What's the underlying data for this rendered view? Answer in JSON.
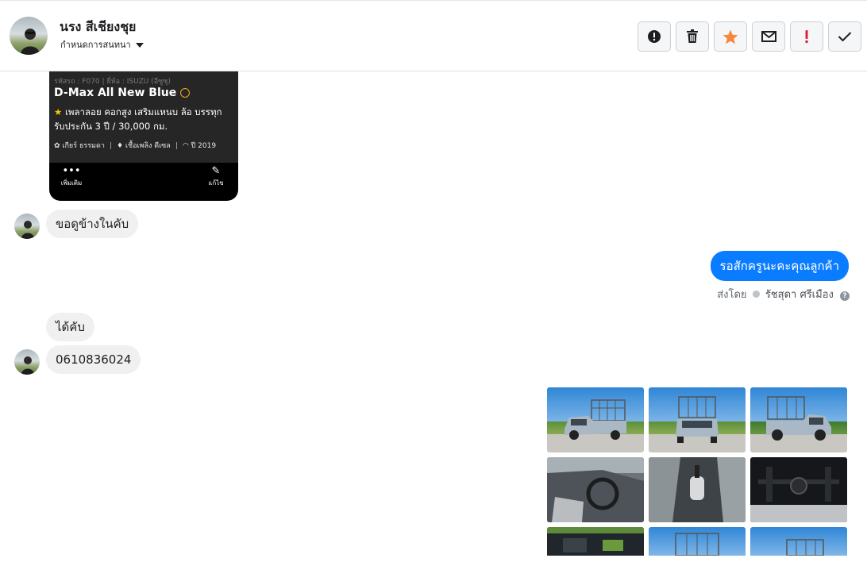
{
  "header": {
    "contact_name": "นรง สีเชียงชุย",
    "assign_label": "กำหนดการสนทนา"
  },
  "toolbar": [
    {
      "name": "report-button",
      "icon": "alert-circle-icon",
      "color": "#1c1e21"
    },
    {
      "name": "delete-button",
      "icon": "trash-icon",
      "color": "#1c1e21"
    },
    {
      "name": "star-button",
      "icon": "star-icon",
      "color": "#f5883b"
    },
    {
      "name": "mark-unread-button",
      "icon": "envelope-icon",
      "color": "#1c1e21"
    },
    {
      "name": "follow-up-button",
      "icon": "exclamation-icon",
      "color": "#e41e3f"
    },
    {
      "name": "mark-done-button",
      "icon": "check-icon",
      "color": "#1c1e21"
    }
  ],
  "listing_card": {
    "meta": "รหัสรถ : F070 | ยี่ห้อ : ISUZU (อีซูซุ)",
    "model": "D-Max All New Blue",
    "features": "เพลาลอย คอกสูง เสริมแหนบ ล้อ บรรทุก รับประกัน 3 ปี / 30,000 กม.",
    "gear": "เกียร์ ธรรมดา",
    "fuel": "เชื้อเพลิง ดีเซล",
    "year": "ปี 2019",
    "more_label": "เพิ่มเติม",
    "edit_label": "แก้ไข"
  },
  "messages": {
    "in_1": "ขอดูข้างในคับ",
    "out_1": "รอสักครูนะคะคุณลูกค้า",
    "sent_by_prefix": "ส่งโดย",
    "sent_by_agent": "รัชสุดา ศรีเมือง",
    "in_2": "ได้คับ",
    "in_3": "0610836024"
  },
  "colors": {
    "outgoing_bubble": "#0a7cff",
    "incoming_bubble": "#f0f0f0"
  }
}
